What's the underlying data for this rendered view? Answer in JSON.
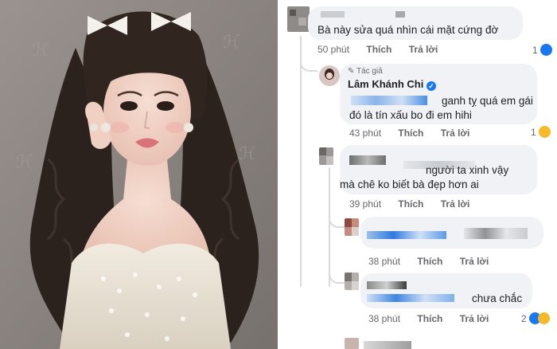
{
  "photo": {
    "description_colors": {
      "bg": "#8e8784",
      "hair": "#2a201c",
      "dress": "#e9e2d6"
    }
  },
  "comments": [
    {
      "text_lines": [
        "Bà này sửa quá nhìn cái mặt cứng đờ"
      ],
      "time": "50 phút",
      "like": "Thích",
      "reply": "Trả lời",
      "reaction_count": "1",
      "reaction": "like-icon"
    },
    {
      "author_badge": "Tác giả",
      "author": "Lâm Khánh Chi",
      "text_lines": [
        "ganh tỵ quá em gái",
        "đó là tín xấu bo đi em hihi"
      ],
      "time": "43 phút",
      "like": "Thích",
      "reply": "Trả lời",
      "reaction_count": "1",
      "reaction": "haha-icon"
    },
    {
      "text_lines": [
        "người ta xinh vậy",
        "mà chê ko biết bà đẹp hơn ai"
      ],
      "time": "39 phút",
      "like": "Thích",
      "reply": "Trả lời"
    },
    {
      "text_lines": [
        ""
      ],
      "time": "38 phút",
      "like": "Thích",
      "reply": "Trả lời"
    },
    {
      "text_lines": [
        "chưa chắc"
      ],
      "time": "38 phút",
      "like": "Thích",
      "reply": "Trả lời",
      "reaction_count": "2",
      "reaction": "like-icon"
    }
  ],
  "colors": {
    "accent_blue": "#1877f2",
    "bubble": "#f0f2f5",
    "meta": "#65676b"
  }
}
